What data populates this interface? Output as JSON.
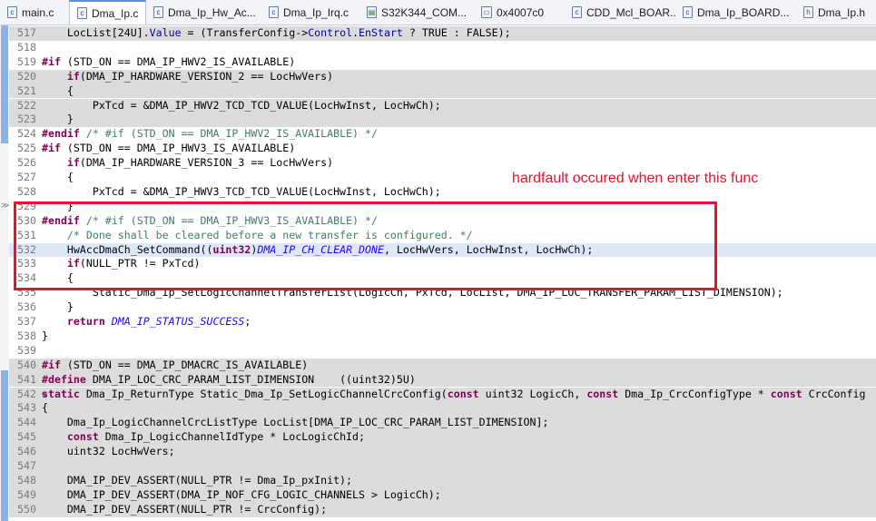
{
  "tabs": [
    {
      "icon": "c-file-icon",
      "glyph": "c",
      "label": "main.c",
      "active": false
    },
    {
      "icon": "c-file-icon",
      "glyph": "c",
      "label": "Dma_Ip.c",
      "active": true,
      "close": "✕"
    },
    {
      "icon": "c-file-icon",
      "glyph": "c",
      "label": "Dma_Ip_Hw_Ac...",
      "active": false
    },
    {
      "icon": "c-file-icon",
      "glyph": "c",
      "label": "Dma_Ip_Irq.c",
      "active": false
    },
    {
      "icon": "register-file-icon",
      "glyph": "▤",
      "label": "S32K344_COM...",
      "active": false
    },
    {
      "icon": "memory-view-icon",
      "glyph": "▭",
      "label": "0x4007c0",
      "active": false
    },
    {
      "icon": "c-file-icon",
      "glyph": "c",
      "label": "CDD_Mcl_BOAR...",
      "active": false
    },
    {
      "icon": "c-file-icon",
      "glyph": "c",
      "label": "Dma_Ip_BOARD...",
      "active": false
    },
    {
      "icon": "h-file-icon",
      "glyph": "h",
      "label": "Dma_Ip.h",
      "active": false
    }
  ],
  "lines": [
    {
      "n": "517",
      "shade": true,
      "tokens": [
        [
          "",
          "    LocList[24U]."
        ],
        [
          "fld",
          "Value"
        ],
        [
          "",
          " = (TransferConfig->"
        ],
        [
          "fld",
          "Control"
        ],
        [
          "",
          "."
        ],
        [
          "fld",
          "EnStart"
        ],
        [
          "",
          " ? TRUE : FALSE);"
        ]
      ]
    },
    {
      "n": "518",
      "shade": false,
      "tokens": []
    },
    {
      "n": "519",
      "shade": false,
      "tokens": [
        [
          "kw",
          "#if"
        ],
        [
          "",
          " (STD_ON == DMA_IP_HWV2_IS_AVAILABLE)"
        ]
      ]
    },
    {
      "n": "520",
      "shade": true,
      "tokens": [
        [
          "",
          "    "
        ],
        [
          "kw",
          "if"
        ],
        [
          "",
          "(DMA_IP_HARDWARE_VERSION_2 == LocHwVers)"
        ]
      ]
    },
    {
      "n": "521",
      "shade": true,
      "tokens": [
        [
          "",
          "    {"
        ]
      ]
    },
    {
      "n": "522",
      "shade": true,
      "tokens": [
        [
          "",
          "        PxTcd = &DMA_IP_HWV2_TCD_TCD_VALUE(LocHwInst, LocHwCh);"
        ]
      ]
    },
    {
      "n": "523",
      "shade": true,
      "tokens": [
        [
          "",
          "    }"
        ]
      ]
    },
    {
      "n": "524",
      "shade": false,
      "tokens": [
        [
          "kw",
          "#endif"
        ],
        [
          "cm",
          " /* #if (STD_ON == DMA_IP_HWV2_IS_AVAILABLE) */"
        ]
      ]
    },
    {
      "n": "525",
      "shade": false,
      "tokens": [
        [
          "kw",
          "#if"
        ],
        [
          "",
          " (STD_ON == DMA_IP_HWV3_IS_AVAILABLE)"
        ]
      ]
    },
    {
      "n": "526",
      "shade": false,
      "tokens": [
        [
          "",
          "    "
        ],
        [
          "kw",
          "if"
        ],
        [
          "",
          "(DMA_IP_HARDWARE_VERSION_3 == LocHwVers)"
        ]
      ]
    },
    {
      "n": "527",
      "shade": false,
      "tokens": [
        [
          "",
          "    {"
        ]
      ]
    },
    {
      "n": "528",
      "shade": false,
      "tokens": [
        [
          "",
          "        PxTcd = &DMA_IP_HWV3_TCD_TCD_VALUE(LocHwInst, LocHwCh);"
        ]
      ]
    },
    {
      "n": "529",
      "shade": false,
      "tokens": [
        [
          "",
          "    }"
        ]
      ]
    },
    {
      "n": "530",
      "shade": false,
      "tokens": [
        [
          "kw",
          "#endif"
        ],
        [
          "cm",
          " /* #if (STD_ON == DMA_IP_HWV3_IS_AVAILABLE) */"
        ]
      ]
    },
    {
      "n": "531",
      "shade": false,
      "tokens": [
        [
          "cm",
          "    /* Done shall be cleared before a new transfer is configured. */"
        ]
      ]
    },
    {
      "n": "532",
      "shade": false,
      "hl": true,
      "tokens": [
        [
          "",
          "    HwAccDmaCh_SetCommand(("
        ],
        [
          "kw",
          "uint32"
        ],
        [
          "",
          ")"
        ],
        [
          "mac",
          "DMA_IP_CH_CLEAR_DONE"
        ],
        [
          "",
          ", LocHwVers, LocHwInst, LocHwCh);"
        ]
      ]
    },
    {
      "n": "533",
      "shade": false,
      "tokens": [
        [
          "",
          "    "
        ],
        [
          "kw",
          "if"
        ],
        [
          "",
          "(NULL_PTR != PxTcd)"
        ]
      ]
    },
    {
      "n": "534",
      "shade": false,
      "tokens": [
        [
          "",
          "    {"
        ]
      ]
    },
    {
      "n": "535",
      "shade": false,
      "tokens": [
        [
          "",
          "        Static_Dma_Ip_SetLogicChannelTransferList(LogicCh, PxTcd, LocList, DMA_IP_LOC_TRANSFER_PARAM_LIST_DIMENSION);"
        ]
      ]
    },
    {
      "n": "536",
      "shade": false,
      "tokens": [
        [
          "",
          "    }"
        ]
      ]
    },
    {
      "n": "537",
      "shade": false,
      "tokens": [
        [
          "",
          "    "
        ],
        [
          "kw",
          "return"
        ],
        [
          "",
          " "
        ],
        [
          "mac",
          "DMA_IP_STATUS_SUCCESS"
        ],
        [
          "",
          ";"
        ]
      ]
    },
    {
      "n": "538",
      "shade": false,
      "tokens": [
        [
          "",
          "}"
        ]
      ]
    },
    {
      "n": "539",
      "shade": false,
      "tokens": []
    },
    {
      "n": "540",
      "shade": true,
      "tokens": [
        [
          "kw",
          "#if"
        ],
        [
          "",
          " (STD_ON == DMA_IP_DMACRC_IS_AVAILABLE)"
        ]
      ]
    },
    {
      "n": "541",
      "shade": true,
      "tokens": [
        [
          "kw",
          "#define"
        ],
        [
          "",
          " DMA_IP_LOC_CRC_PARAM_LIST_DIMENSION    ((uint32)5U)"
        ]
      ]
    },
    {
      "n": "542",
      "shade": true,
      "fold": "⊖",
      "tokens": [
        [
          "kw",
          "static"
        ],
        [
          "",
          " Dma_Ip_ReturnType Static_Dma_Ip_SetLogicChannelCrcConfig("
        ],
        [
          "kw",
          "const"
        ],
        [
          "",
          " uint32 LogicCh, "
        ],
        [
          "kw",
          "const"
        ],
        [
          "",
          " Dma_Ip_CrcConfigType * "
        ],
        [
          "kw",
          "const"
        ],
        [
          "",
          " CrcConfig"
        ]
      ]
    },
    {
      "n": "543",
      "shade": true,
      "tokens": [
        [
          "",
          "{"
        ]
      ]
    },
    {
      "n": "544",
      "shade": true,
      "tokens": [
        [
          "",
          "    Dma_Ip_LogicChannelCrcListType LocList[DMA_IP_LOC_CRC_PARAM_LIST_DIMENSION];"
        ]
      ]
    },
    {
      "n": "545",
      "shade": true,
      "tokens": [
        [
          "",
          "    "
        ],
        [
          "kw",
          "const"
        ],
        [
          "",
          " Dma_Ip_LogicChannelIdType * LocLogicChId;"
        ]
      ]
    },
    {
      "n": "546",
      "shade": true,
      "tokens": [
        [
          "",
          "    uint32 LocHwVers;"
        ]
      ]
    },
    {
      "n": "547",
      "shade": true,
      "tokens": []
    },
    {
      "n": "548",
      "shade": true,
      "tokens": [
        [
          "",
          "    DMA_IP_DEV_ASSERT(NULL_PTR != Dma_Ip_pxInit);"
        ]
      ]
    },
    {
      "n": "549",
      "shade": true,
      "tokens": [
        [
          "",
          "    DMA_IP_DEV_ASSERT(DMA_IP_NOF_CFG_LOGIC_CHANNELS > LogicCh);"
        ]
      ]
    },
    {
      "n": "550",
      "shade": true,
      "tokens": [
        [
          "",
          "    DMA_IP_DEV_ASSERT(NULL_PTR != CrcConfig);"
        ]
      ]
    }
  ],
  "annotation": {
    "text": "hardfault occured when enter this func",
    "color": "#e8132a"
  },
  "colors": {
    "keyword": "#7f0055",
    "comment": "#3f7f5f",
    "macro": "#2a00ff",
    "field": "#0000c0",
    "shade": "#dcdcdc",
    "current_line": "#dde8f6"
  }
}
